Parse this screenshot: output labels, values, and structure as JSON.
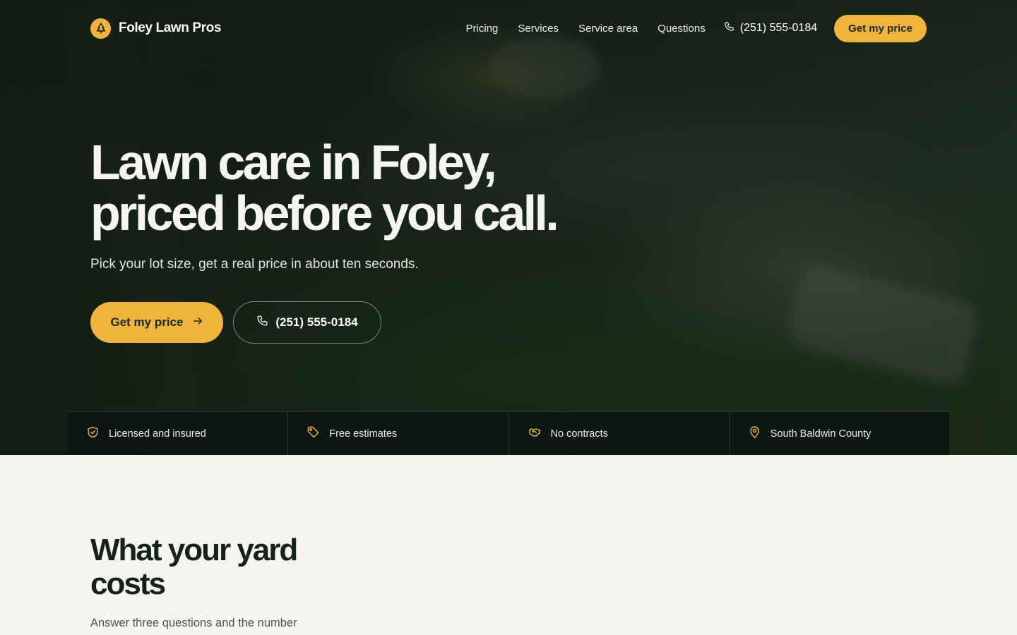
{
  "brand": {
    "name": "Foley Lawn Pros",
    "logo_icon": "tree-icon",
    "accent": "#f0b43c"
  },
  "nav": {
    "links": [
      "Pricing",
      "Services",
      "Service area",
      "Questions"
    ],
    "phone": "(251) 555-0184",
    "cta": "Get my price"
  },
  "hero": {
    "headline_line1": "Lawn care in Foley,",
    "headline_line2": "priced before you call.",
    "subhead": "Pick your lot size, get a real price in about ten seconds.",
    "primary_cta": "Get my price",
    "secondary_cta": "(251) 555-0184"
  },
  "trust": [
    {
      "icon": "shield-check-icon",
      "label": "Licensed and insured"
    },
    {
      "icon": "price-tag-icon",
      "label": "Free estimates"
    },
    {
      "icon": "handshake-icon",
      "label": "No contracts"
    },
    {
      "icon": "map-pin-icon",
      "label": "South Baldwin County"
    }
  ],
  "pricing": {
    "title_line1": "What your yard",
    "title_line2": "costs",
    "subtitle": "Answer three questions and the number"
  }
}
